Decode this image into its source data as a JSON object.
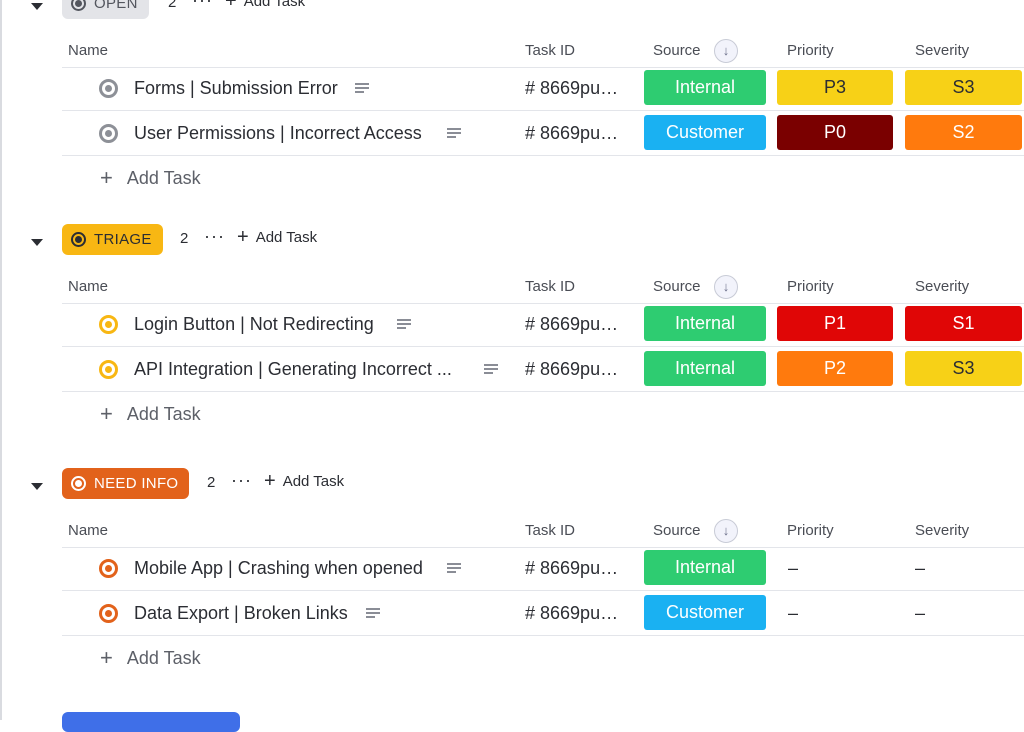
{
  "groups": [
    {
      "status": "OPEN",
      "count": "2",
      "add_task_label": "Add Task",
      "pill_bg": "#e3e4e8",
      "pill_fg": "#53565e",
      "ring_color": "#8d9097",
      "columns": {
        "name": "Name",
        "task_id": "Task ID",
        "source": "Source",
        "priority": "Priority",
        "severity": "Severity"
      },
      "tasks": [
        {
          "name": "Forms | Submission Error",
          "task_id": "# 8669pu…",
          "source": "Internal",
          "source_color": "#2ecc71",
          "priority": "P3",
          "priority_color": "#f7d117",
          "priority_fg": "#2b2d33",
          "severity": "S3",
          "severity_color": "#f7d117",
          "severity_fg": "#2b2d33"
        },
        {
          "name": "User Permissions | Incorrect Access",
          "task_id": "# 8669pu…",
          "source": "Customer",
          "source_color": "#1ab1f2",
          "priority": "P0",
          "priority_color": "#7a0000",
          "priority_fg": "#ffffff",
          "severity": "S2",
          "severity_color": "#ff7a0d",
          "severity_fg": "#ffffff"
        }
      ],
      "add_row_label": "Add Task"
    },
    {
      "status": "TRIAGE",
      "count": "2",
      "add_task_label": "Add Task",
      "pill_bg": "#f8b713",
      "pill_fg": "#2b2d33",
      "ring_color": "#f8b713",
      "columns": {
        "name": "Name",
        "task_id": "Task ID",
        "source": "Source",
        "priority": "Priority",
        "severity": "Severity"
      },
      "tasks": [
        {
          "name": "Login Button | Not Redirecting",
          "task_id": "# 8669pu…",
          "source": "Internal",
          "source_color": "#2ecc71",
          "priority": "P1",
          "priority_color": "#e00606",
          "priority_fg": "#ffffff",
          "severity": "S1",
          "severity_color": "#e00606",
          "severity_fg": "#ffffff"
        },
        {
          "name": "API Integration | Generating Incorrect ...",
          "task_id": "# 8669pu…",
          "source": "Internal",
          "source_color": "#2ecc71",
          "priority": "P2",
          "priority_color": "#ff7a0d",
          "priority_fg": "#ffffff",
          "severity": "S3",
          "severity_color": "#f7d117",
          "severity_fg": "#2b2d33"
        }
      ],
      "add_row_label": "Add Task"
    },
    {
      "status": "NEED INFO",
      "count": "2",
      "add_task_label": "Add Task",
      "pill_bg": "#e2621b",
      "pill_fg": "#ffffff",
      "ring_color": "#e2621b",
      "columns": {
        "name": "Name",
        "task_id": "Task ID",
        "source": "Source",
        "priority": "Priority",
        "severity": "Severity"
      },
      "tasks": [
        {
          "name": "Mobile App | Crashing when opened",
          "task_id": "# 8669pu…",
          "source": "Internal",
          "source_color": "#2ecc71",
          "priority": "–",
          "priority_color": "",
          "priority_fg": "",
          "severity": "–",
          "severity_color": "",
          "severity_fg": ""
        },
        {
          "name": "Data Export | Broken Links",
          "task_id": "# 8669pu…",
          "source": "Customer",
          "source_color": "#1ab1f2",
          "priority": "–",
          "priority_color": "",
          "priority_fg": "",
          "severity": "–",
          "severity_color": "",
          "severity_fg": ""
        }
      ],
      "add_row_label": "Add Task"
    }
  ],
  "icons": {
    "sort": "arrow-down-icon",
    "more": "more-dots-icon",
    "add": "plus-icon",
    "description": "description-lines-icon",
    "collapse": "caret-down-icon"
  }
}
